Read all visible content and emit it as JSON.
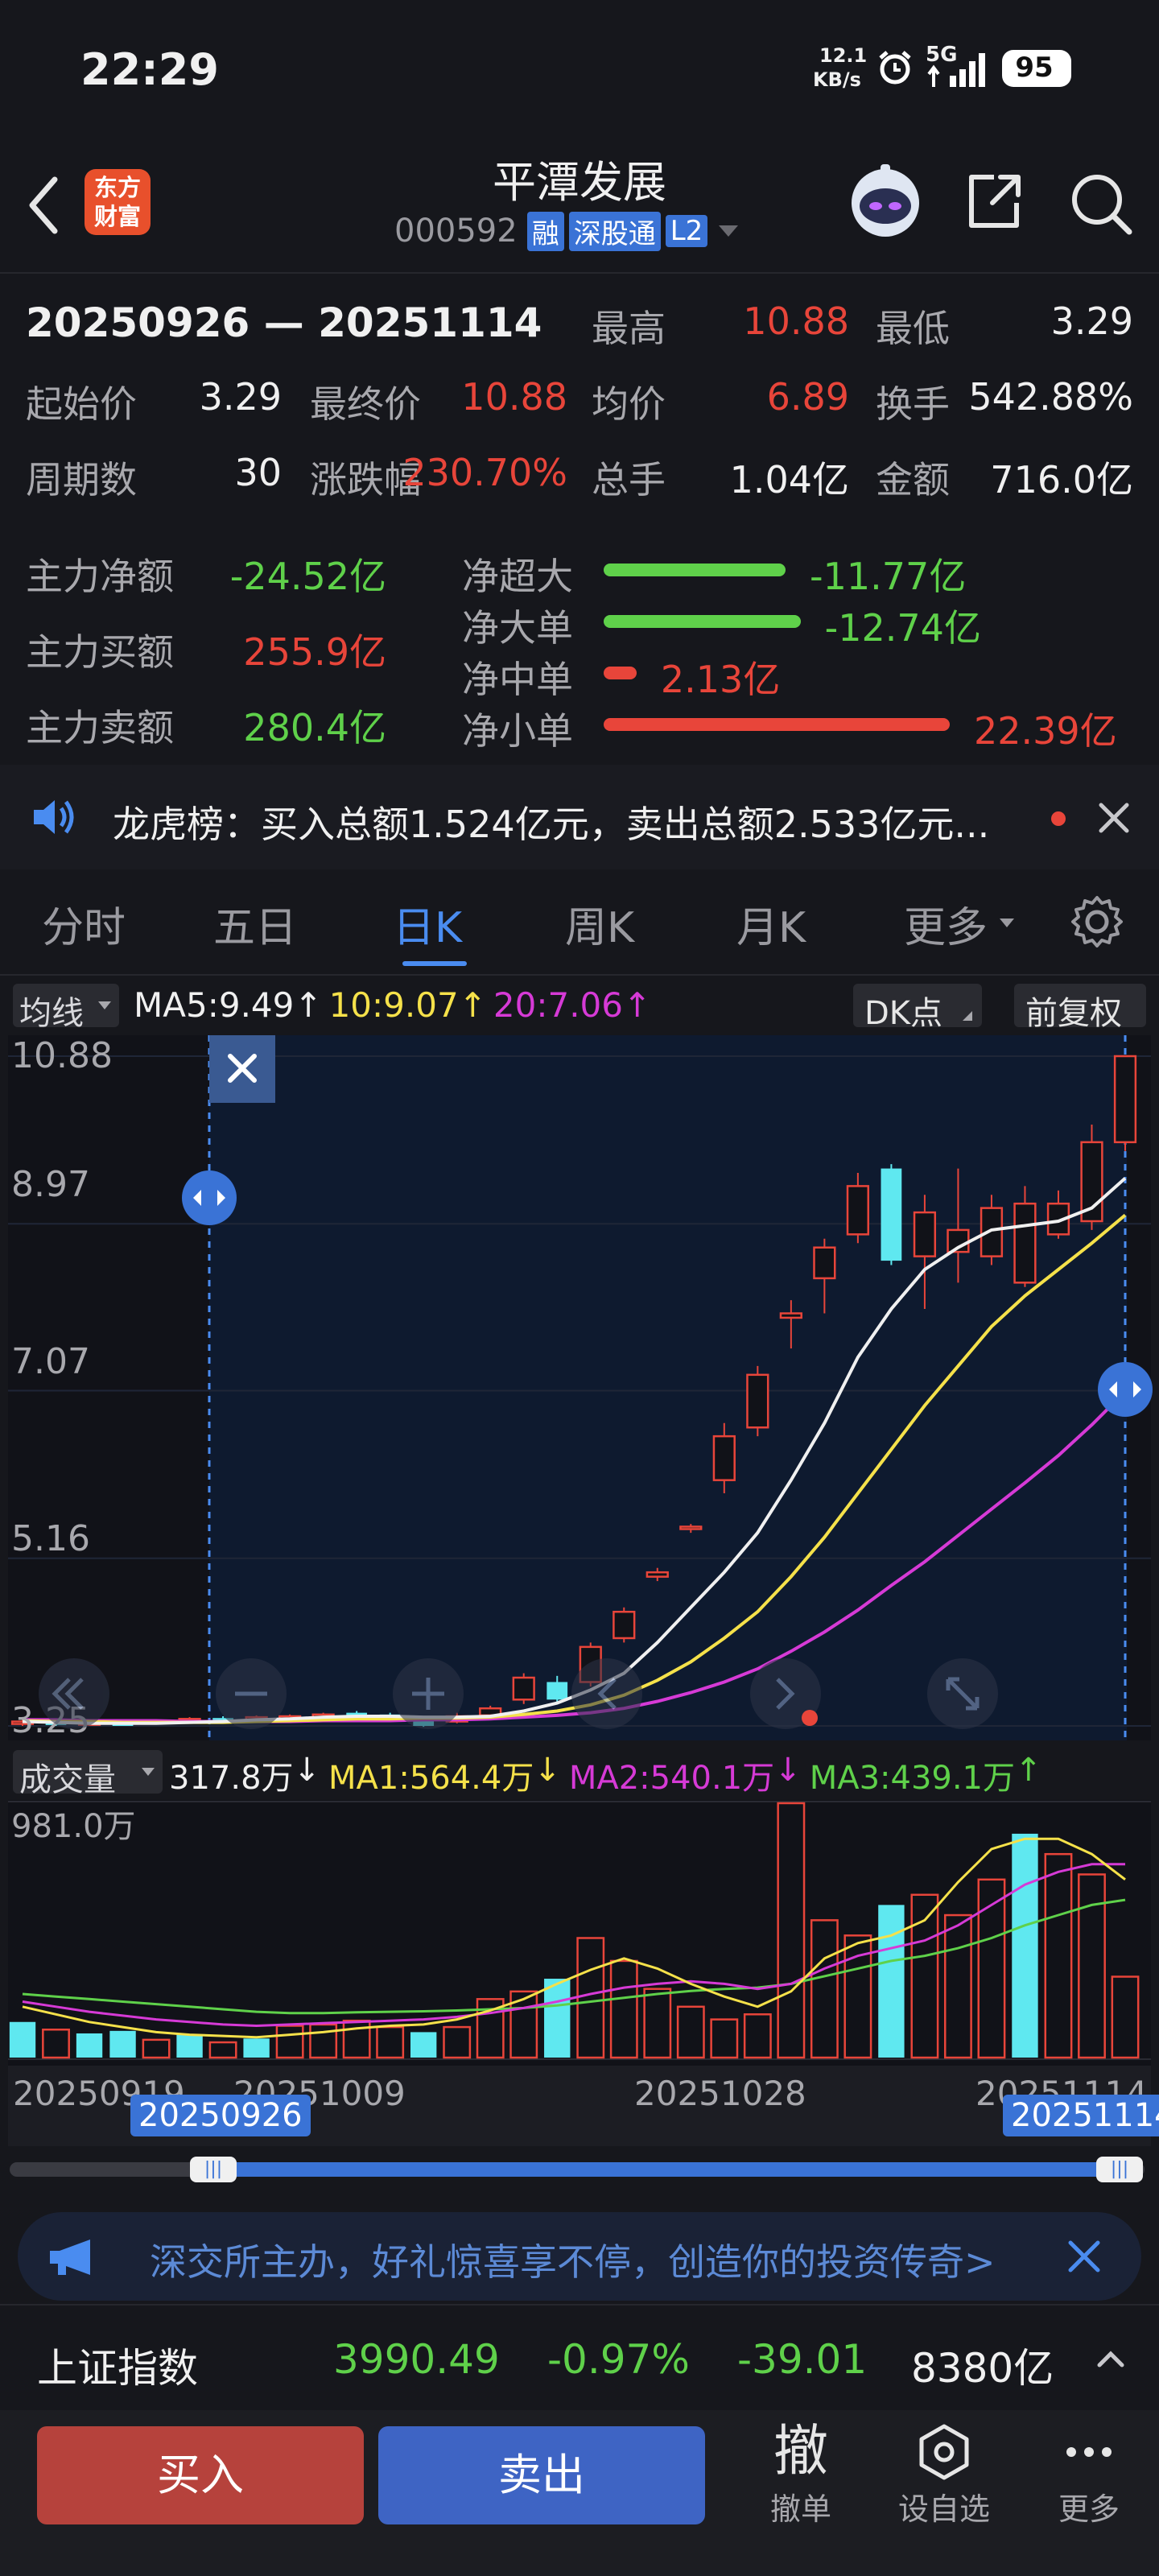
{
  "status": {
    "time": "22:29",
    "speed_value": "12.1",
    "speed_unit": "KB/s",
    "network": "5G",
    "battery": "95"
  },
  "header": {
    "title": "平潭发展",
    "code": "000592",
    "badges": [
      "融",
      "深股通",
      "L2"
    ],
    "logo_line1": "东方",
    "logo_line2": "财富"
  },
  "summary": {
    "range": "20250926 — 20251114",
    "high_label": "最高",
    "high": "10.88",
    "low_label": "最低",
    "low": "3.29",
    "open_label": "起始价",
    "open": "3.29",
    "close_label": "最终价",
    "close": "10.88",
    "avg_label": "均价",
    "avg": "6.89",
    "turnover_label": "换手",
    "turnover": "542.88%",
    "periods_label": "周期数",
    "periods": "30",
    "change_label": "涨跌幅",
    "change": "230.70%",
    "volume_label": "总手",
    "volume": "1.04亿",
    "amount_label": "金额",
    "amount": "716.0亿"
  },
  "capital": {
    "net_label": "主力净额",
    "net": "-24.52亿",
    "buy_label": "主力买额",
    "buy": "255.9亿",
    "sell_label": "主力卖额",
    "sell": "280.4亿",
    "flows": [
      {
        "label": "净超大",
        "value": "-11.77亿",
        "amount": -11.77,
        "color": "#5fd14a"
      },
      {
        "label": "净大单",
        "value": "-12.74亿",
        "amount": -12.74,
        "color": "#5fd14a"
      },
      {
        "label": "净中单",
        "value": "2.13亿",
        "amount": 2.13,
        "color": "#e8453a"
      },
      {
        "label": "净小单",
        "value": "22.39亿",
        "amount": 22.39,
        "color": "#e8453a"
      }
    ]
  },
  "notice": {
    "text": "龙虎榜：买入总额1.524亿元，卖出总额2.533亿元..."
  },
  "tabs": [
    {
      "label": "分时"
    },
    {
      "label": "五日"
    },
    {
      "label": "日K"
    },
    {
      "label": "周K"
    },
    {
      "label": "月K"
    },
    {
      "label": "更多"
    }
  ],
  "kline_bar": {
    "ma_button": "均线",
    "ma5": "MA5:9.49",
    "ma10": "10:9.07",
    "ma20": "20:7.06",
    "dk": "DK点",
    "adjust": "前复权"
  },
  "vol_bar": {
    "label": "成交量",
    "vol": "317.8万",
    "ma1": "MA1:564.4万",
    "ma2": "MA2:540.1万",
    "ma3": "MA3:439.1万",
    "vol_top": "981.0万"
  },
  "x_axis": {
    "d1": "20250919",
    "d2": "20251009",
    "d3": "20251028",
    "d4": "20251114",
    "sel_start": "20250926",
    "sel_end": "20251114"
  },
  "ad": {
    "text": "深交所主办，好礼惊喜享不停，创造你的投资传奇>"
  },
  "index": {
    "name": "上证指数",
    "value": "3990.49",
    "pct": "-0.97%",
    "chg": "-39.01",
    "amount": "8380亿"
  },
  "bottom": {
    "buy": "买入",
    "sell": "卖出",
    "cancel_glyph": "撤",
    "cancel": "撤单",
    "custom": "设自选",
    "more": "更多"
  },
  "chart_data": {
    "type": "candlestick",
    "price_ticks": [
      "10.88",
      "8.97",
      "7.07",
      "5.16",
      "3.25"
    ],
    "ylim": [
      3.25,
      10.88
    ],
    "candles": [
      {
        "o": 3.28,
        "c": 3.3,
        "h": 3.33,
        "l": 3.25,
        "up": true
      },
      {
        "o": 3.31,
        "c": 3.26,
        "h": 3.33,
        "l": 3.25,
        "up": false
      },
      {
        "o": 3.27,
        "c": 3.29,
        "h": 3.31,
        "l": 3.25,
        "up": true
      },
      {
        "o": 3.29,
        "c": 3.25,
        "h": 3.31,
        "l": 3.25,
        "up": false
      },
      {
        "o": 3.29,
        "c": 3.31,
        "h": 3.32,
        "l": 3.27,
        "up": true
      },
      {
        "o": 3.3,
        "c": 3.33,
        "h": 3.35,
        "l": 3.28,
        "up": true
      },
      {
        "o": 3.34,
        "c": 3.32,
        "h": 3.36,
        "l": 3.3,
        "up": false
      },
      {
        "o": 3.33,
        "c": 3.35,
        "h": 3.37,
        "l": 3.31,
        "up": true
      },
      {
        "o": 3.35,
        "c": 3.36,
        "h": 3.38,
        "l": 3.33,
        "up": true
      },
      {
        "o": 3.36,
        "c": 3.38,
        "h": 3.4,
        "l": 3.34,
        "up": true
      },
      {
        "o": 3.4,
        "c": 3.37,
        "h": 3.42,
        "l": 3.35,
        "up": false
      },
      {
        "o": 3.38,
        "c": 3.36,
        "h": 3.4,
        "l": 3.34,
        "up": false
      },
      {
        "o": 3.32,
        "c": 3.25,
        "h": 3.34,
        "l": 3.24,
        "up": false
      },
      {
        "o": 3.3,
        "c": 3.36,
        "h": 3.4,
        "l": 3.28,
        "up": true
      },
      {
        "o": 3.37,
        "c": 3.45,
        "h": 3.48,
        "l": 3.35,
        "up": true
      },
      {
        "o": 3.55,
        "c": 3.8,
        "h": 3.85,
        "l": 3.5,
        "up": true
      },
      {
        "o": 3.75,
        "c": 3.55,
        "h": 3.82,
        "l": 3.5,
        "up": false
      },
      {
        "o": 3.75,
        "c": 4.15,
        "h": 4.2,
        "l": 3.7,
        "up": true
      },
      {
        "o": 4.25,
        "c": 4.55,
        "h": 4.6,
        "l": 4.2,
        "up": true
      },
      {
        "o": 4.95,
        "c": 5.0,
        "h": 5.05,
        "l": 4.9,
        "up": true
      },
      {
        "o": 5.5,
        "c": 5.52,
        "h": 5.55,
        "l": 5.45,
        "up": true
      },
      {
        "o": 6.05,
        "c": 6.55,
        "h": 6.7,
        "l": 5.9,
        "up": true
      },
      {
        "o": 6.65,
        "c": 7.25,
        "h": 7.35,
        "l": 6.55,
        "up": true
      },
      {
        "o": 7.9,
        "c": 7.95,
        "h": 8.1,
        "l": 7.55,
        "up": true
      },
      {
        "o": 8.35,
        "c": 8.7,
        "h": 8.8,
        "l": 7.95,
        "up": true
      },
      {
        "o": 8.85,
        "c": 9.4,
        "h": 9.55,
        "l": 8.75,
        "up": true
      },
      {
        "o": 9.6,
        "c": 8.55,
        "h": 9.65,
        "l": 8.5,
        "up": false
      },
      {
        "o": 8.6,
        "c": 9.1,
        "h": 9.3,
        "l": 8.0,
        "up": true
      },
      {
        "o": 8.65,
        "c": 8.9,
        "h": 9.6,
        "l": 8.3,
        "up": true
      },
      {
        "o": 8.6,
        "c": 9.15,
        "h": 9.3,
        "l": 8.5,
        "up": true
      },
      {
        "o": 8.3,
        "c": 9.2,
        "h": 9.4,
        "l": 8.25,
        "up": true
      },
      {
        "o": 8.85,
        "c": 9.2,
        "h": 9.35,
        "l": 8.8,
        "up": true
      },
      {
        "o": 9.0,
        "c": 9.9,
        "h": 10.1,
        "l": 8.9,
        "up": true
      },
      {
        "o": 9.9,
        "c": 10.88,
        "h": 10.88,
        "l": 9.8,
        "up": true
      }
    ],
    "ma5": [
      3.3,
      3.29,
      3.28,
      3.28,
      3.28,
      3.29,
      3.3,
      3.32,
      3.33,
      3.35,
      3.36,
      3.36,
      3.35,
      3.35,
      3.36,
      3.42,
      3.51,
      3.66,
      3.85,
      4.2,
      4.6,
      5.0,
      5.45,
      6.05,
      6.7,
      7.45,
      8.0,
      8.45,
      8.7,
      8.9,
      8.95,
      9.0,
      9.15,
      9.49
    ],
    "ma10": [
      3.31,
      3.3,
      3.3,
      3.29,
      3.29,
      3.29,
      3.29,
      3.3,
      3.31,
      3.32,
      3.33,
      3.33,
      3.34,
      3.34,
      3.35,
      3.38,
      3.42,
      3.49,
      3.6,
      3.77,
      3.98,
      4.25,
      4.55,
      4.95,
      5.4,
      5.9,
      6.4,
      6.9,
      7.35,
      7.8,
      8.15,
      8.45,
      8.75,
      9.07
    ],
    "ma20": [
      3.32,
      3.32,
      3.31,
      3.31,
      3.31,
      3.3,
      3.3,
      3.3,
      3.3,
      3.31,
      3.31,
      3.31,
      3.32,
      3.32,
      3.33,
      3.35,
      3.37,
      3.4,
      3.45,
      3.53,
      3.63,
      3.75,
      3.9,
      4.1,
      4.32,
      4.57,
      4.85,
      5.12,
      5.42,
      5.72,
      6.02,
      6.33,
      6.68,
      7.06
    ],
    "volume": [
      140,
      110,
      95,
      105,
      70,
      90,
      60,
      75,
      125,
      130,
      145,
      120,
      100,
      120,
      230,
      260,
      310,
      470,
      380,
      270,
      200,
      150,
      170,
      1000,
      540,
      480,
      600,
      640,
      560,
      700,
      880,
      800,
      720,
      318
    ],
    "vol_up": [
      false,
      true,
      false,
      false,
      true,
      false,
      true,
      false,
      true,
      true,
      true,
      true,
      false,
      true,
      true,
      true,
      false,
      true,
      true,
      true,
      true,
      true,
      true,
      true,
      true,
      true,
      false,
      true,
      true,
      true,
      false,
      true,
      true,
      true
    ],
    "vol_ma1": [
      200,
      170,
      140,
      120,
      100,
      90,
      85,
      80,
      90,
      100,
      115,
      125,
      130,
      150,
      185,
      230,
      290,
      345,
      390,
      350,
      290,
      240,
      200,
      260,
      390,
      450,
      480,
      540,
      690,
      820,
      860,
      860,
      800,
      700
    ],
    "vol_ma2": [
      220,
      200,
      180,
      165,
      150,
      140,
      130,
      125,
      130,
      135,
      140,
      145,
      150,
      160,
      175,
      195,
      220,
      250,
      275,
      290,
      300,
      290,
      270,
      290,
      350,
      400,
      430,
      460,
      520,
      600,
      680,
      730,
      760,
      760
    ],
    "vol_ma3": [
      250,
      240,
      230,
      220,
      210,
      200,
      190,
      180,
      175,
      175,
      178,
      180,
      182,
      185,
      190,
      195,
      205,
      220,
      235,
      250,
      262,
      270,
      275,
      290,
      320,
      350,
      380,
      400,
      430,
      470,
      520,
      560,
      600,
      620
    ],
    "vol_max": 1000
  }
}
